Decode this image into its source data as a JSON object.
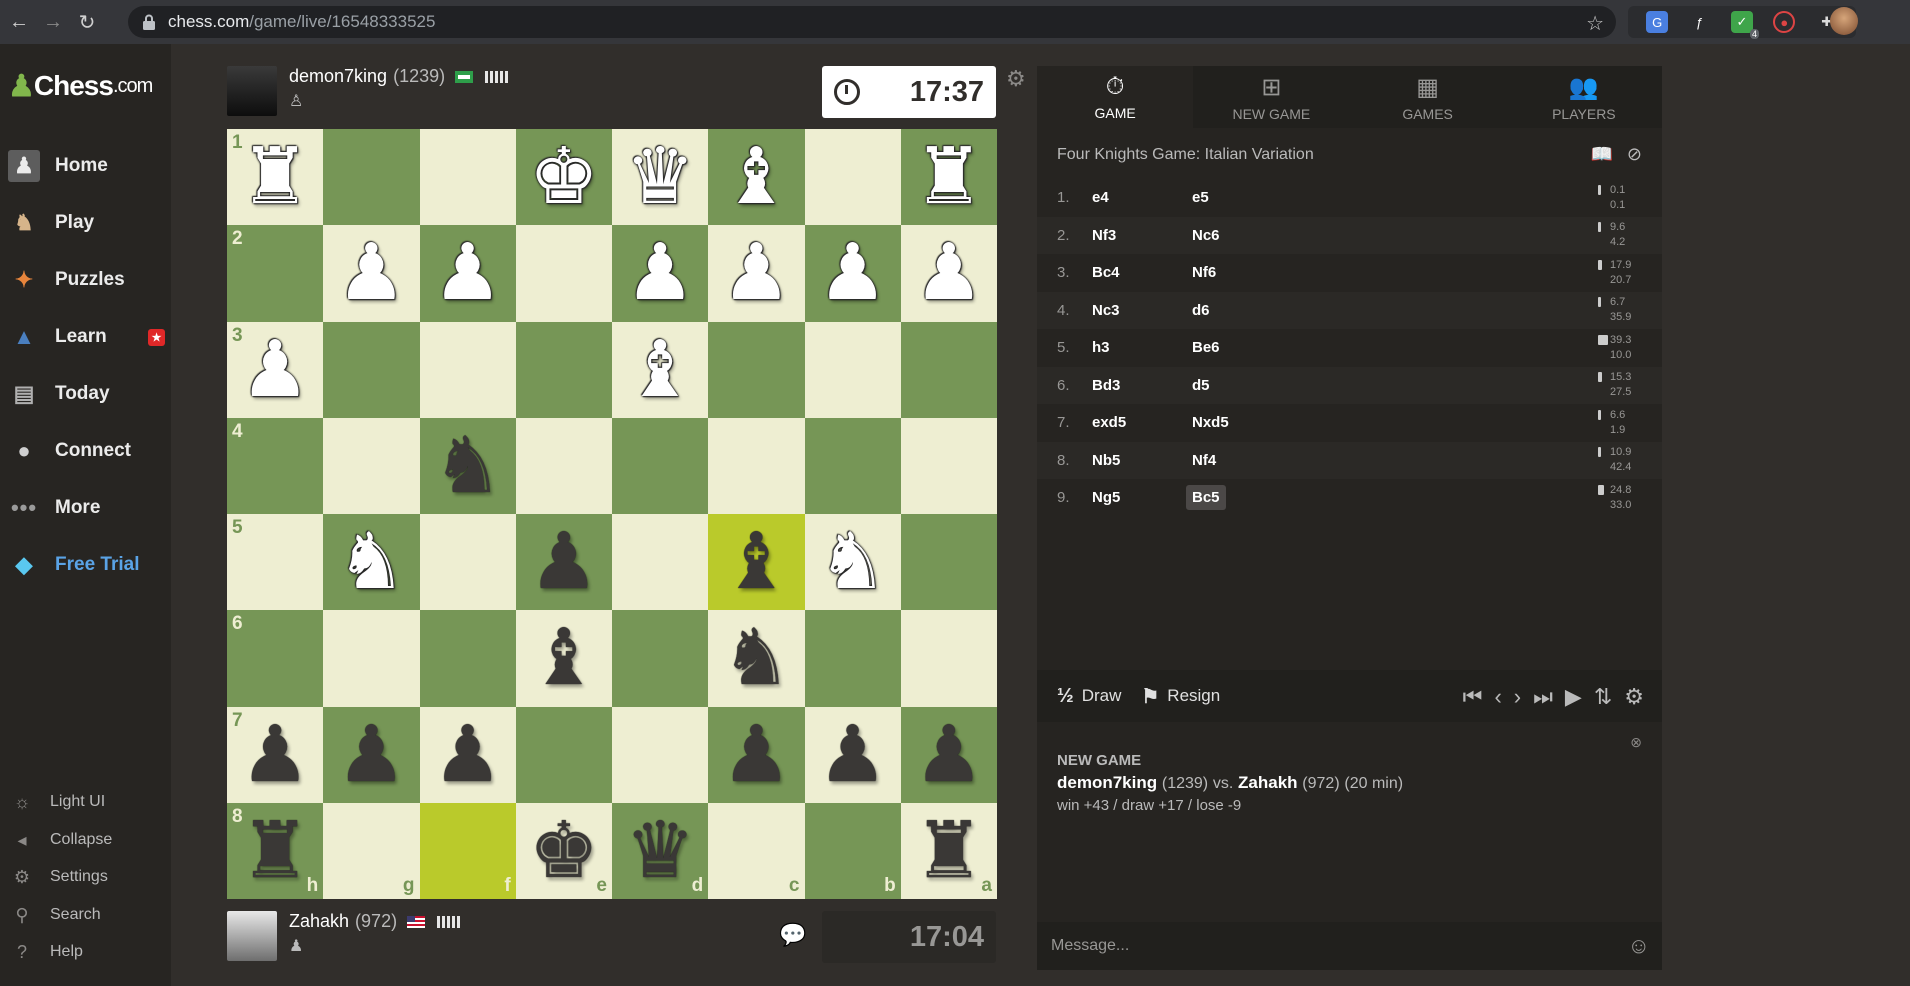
{
  "browser": {
    "url_host": "chess.com",
    "url_path": "/game/live/16548333525"
  },
  "sidebar": {
    "logo_main": "Chess",
    "logo_suffix": ".com",
    "items": [
      {
        "label": "Home"
      },
      {
        "label": "Play"
      },
      {
        "label": "Puzzles"
      },
      {
        "label": "Learn"
      },
      {
        "label": "Today"
      },
      {
        "label": "Connect"
      },
      {
        "label": "More"
      },
      {
        "label": "Free Trial"
      }
    ],
    "bottom": [
      {
        "label": "Light UI"
      },
      {
        "label": "Collapse"
      },
      {
        "label": "Settings"
      },
      {
        "label": "Search"
      },
      {
        "label": "Help"
      }
    ]
  },
  "top_player": {
    "name": "demon7king",
    "rating": "(1239)",
    "clock": "17:37"
  },
  "bottom_player": {
    "name": "Zahakh",
    "rating": "(972)",
    "clock": "17:04"
  },
  "board": {
    "files": [
      "h",
      "g",
      "f",
      "e",
      "d",
      "c",
      "b",
      "a"
    ],
    "ranks": [
      "1",
      "2",
      "3",
      "4",
      "5",
      "6",
      "7",
      "8"
    ],
    "rows": [
      [
        "wR",
        "",
        "",
        "wK",
        "wQ",
        "wB",
        "",
        "wR"
      ],
      [
        "",
        "wP",
        "wP",
        "",
        "wP",
        "wP",
        "wP",
        "wP"
      ],
      [
        "wP",
        "",
        "",
        "",
        "wB",
        "",
        "",
        ""
      ],
      [
        "",
        "",
        "bN",
        "",
        "",
        "",
        "",
        ""
      ],
      [
        "",
        "wN",
        "",
        "bP",
        "",
        "bB",
        "wN",
        ""
      ],
      [
        "",
        "",
        "",
        "bB",
        "",
        "bN",
        "",
        ""
      ],
      [
        "bP",
        "bP",
        "bP",
        "",
        "",
        "bP",
        "bP",
        "bP"
      ],
      [
        "bR",
        "",
        "",
        "bK",
        "bQ",
        "",
        "",
        "bR"
      ]
    ],
    "highlights": [
      [
        4,
        5
      ],
      [
        7,
        2
      ]
    ]
  },
  "panel": {
    "tabs": [
      {
        "label": "GAME"
      },
      {
        "label": "NEW GAME"
      },
      {
        "label": "GAMES"
      },
      {
        "label": "PLAYERS"
      }
    ],
    "opening": "Four Knights Game: Italian Variation",
    "moves": [
      {
        "n": "1.",
        "w": "e4",
        "b": "e5",
        "tw": "0.1",
        "tb": "0.1",
        "fill": 0.03
      },
      {
        "n": "2.",
        "w": "Nf3",
        "b": "Nc6",
        "tw": "9.6",
        "tb": "4.2",
        "fill": 0.12
      },
      {
        "n": "3.",
        "w": "Bc4",
        "b": "Nf6",
        "tw": "17.9",
        "tb": "20.7",
        "fill": 0.22
      },
      {
        "n": "4.",
        "w": "Nc3",
        "b": "d6",
        "tw": "6.7",
        "tb": "35.9",
        "fill": 0.08
      },
      {
        "n": "5.",
        "w": "h3",
        "b": "Be6",
        "tw": "39.3",
        "tb": "10.0",
        "fill": 0.5
      },
      {
        "n": "6.",
        "w": "Bd3",
        "b": "d5",
        "tw": "15.3",
        "tb": "27.5",
        "fill": 0.19
      },
      {
        "n": "7.",
        "w": "exd5",
        "b": "Nxd5",
        "tw": "6.6",
        "tb": "1.9",
        "fill": 0.08
      },
      {
        "n": "8.",
        "w": "Nb5",
        "b": "Nf4",
        "tw": "10.9",
        "tb": "42.4",
        "fill": 0.14
      },
      {
        "n": "9.",
        "w": "Ng5",
        "b": "Bc5",
        "tw": "24.8",
        "tb": "33.0",
        "fill": 0.31
      }
    ],
    "draw_label": "Draw",
    "resign_label": "Resign",
    "draw_symbol": "½",
    "game_info": {
      "title": "NEW GAME",
      "p1": "demon7king",
      "p1_rating": "(1239)",
      "vs": "vs.",
      "p2": "Zahakh",
      "p2_rating": "(972)",
      "time_control": "(20 min)",
      "score": "win +43 / draw +17 / lose -9"
    },
    "message_placeholder": "Message..."
  }
}
